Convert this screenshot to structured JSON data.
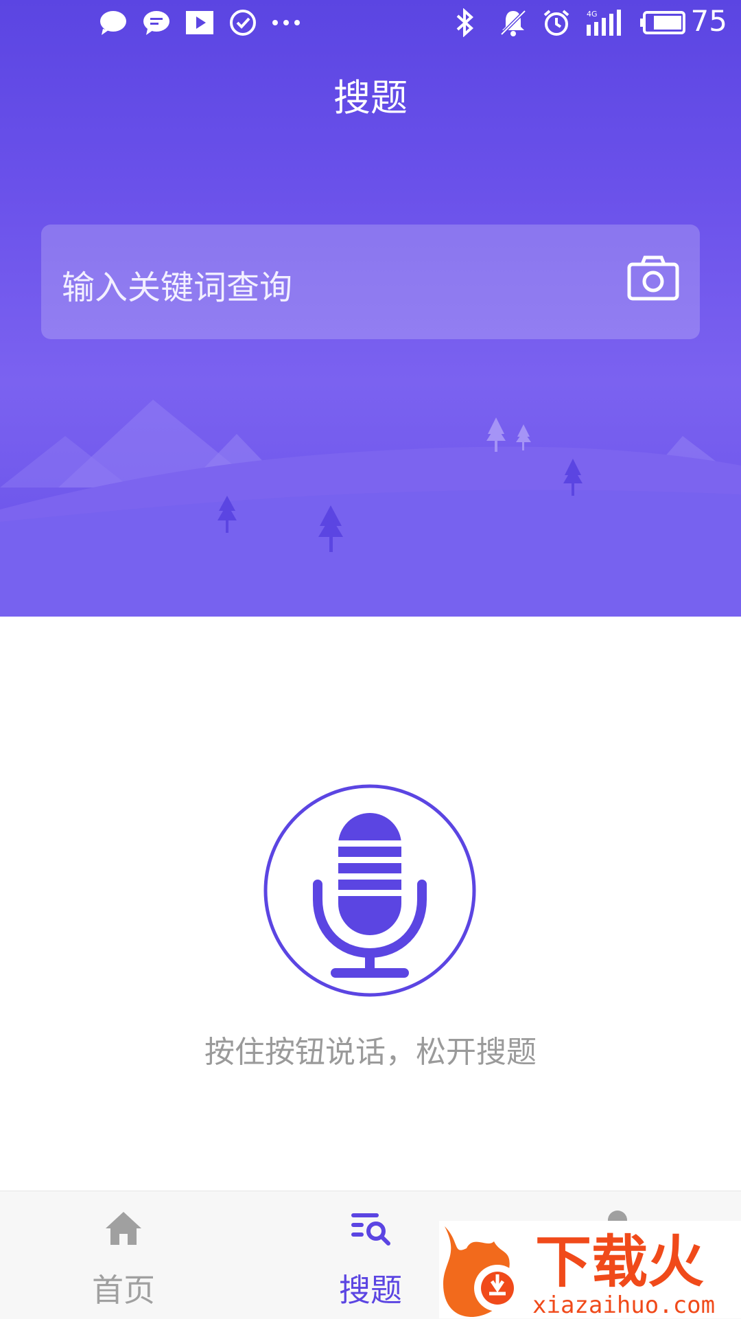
{
  "status_bar": {
    "battery_level": "75",
    "network": "4G",
    "icons": [
      "message-icon",
      "chat-icon",
      "video-icon",
      "check-icon",
      "more-icon",
      "bluetooth-icon",
      "mute-icon",
      "alarm-icon",
      "signal-icon",
      "battery-icon"
    ]
  },
  "header": {
    "title": "搜题"
  },
  "search": {
    "placeholder": "输入关键词查询",
    "camera_icon": "camera-icon"
  },
  "voice": {
    "hint": "按住按钮说话，松开搜题",
    "mic_icon": "microphone-icon"
  },
  "bottom_nav": {
    "items": [
      {
        "label": "首页",
        "icon": "home-icon",
        "active": false
      },
      {
        "label": "搜题",
        "icon": "search-list-icon",
        "active": true
      },
      {
        "label": "",
        "icon": "profile-icon",
        "active": false
      }
    ]
  },
  "watermark": {
    "brand": "下载火",
    "site": "xiazaihuo.com"
  },
  "colors": {
    "accent": "#5b45e2",
    "inactive": "#a0a0a0"
  }
}
